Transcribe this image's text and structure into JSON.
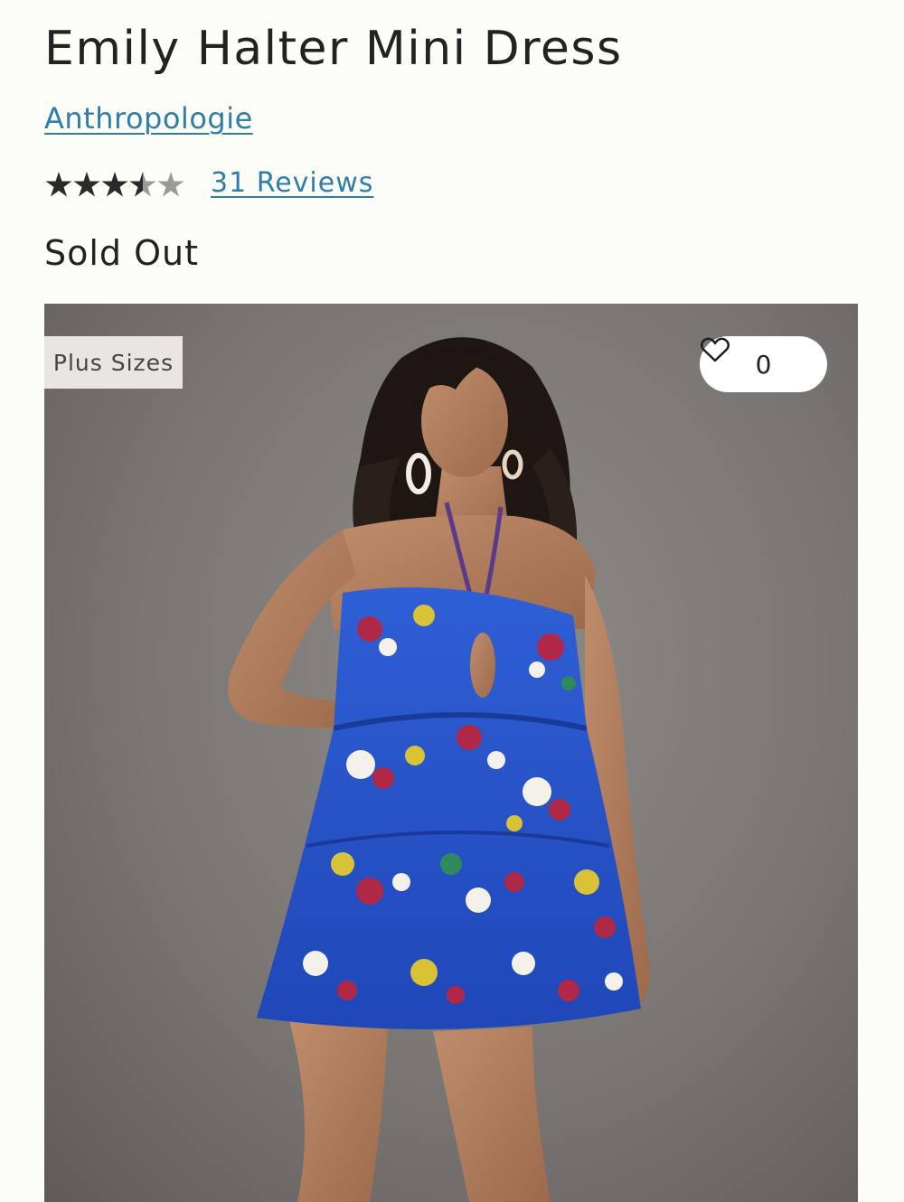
{
  "product": {
    "title": "Emily Halter Mini Dress",
    "brand": "Anthropologie",
    "rating": 3.5,
    "rating_max": 5,
    "reviews_label": "31 Reviews",
    "status": "Sold Out"
  },
  "image": {
    "badge": "Plus Sizes",
    "favorite_count": "0",
    "icons": {
      "favorite": "heart-outline-icon"
    }
  },
  "colors": {
    "link": "#2e7ea8",
    "star_filled": "#2a2a2a",
    "star_empty": "#9a9a9a",
    "dress_blue": "#2a55c8"
  }
}
